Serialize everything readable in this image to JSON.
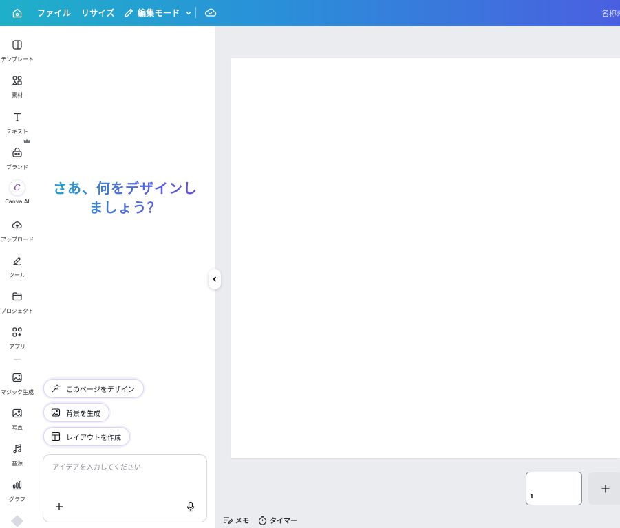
{
  "topbar": {
    "file": "ファイル",
    "resize": "リサイズ",
    "edit_mode": "編集モード",
    "doc_title": "名称未"
  },
  "rail": {
    "items": [
      {
        "label": "テンプレート",
        "icon": "template-icon"
      },
      {
        "label": "素材",
        "icon": "elements-icon"
      },
      {
        "label": "テキスト",
        "icon": "text-icon"
      },
      {
        "label": "ブランド",
        "icon": "brand-icon"
      },
      {
        "label": "Canva AI",
        "icon": "canva-ai-icon"
      },
      {
        "label": "アップロード",
        "icon": "upload-icon"
      },
      {
        "label": "ツール",
        "icon": "tools-icon"
      },
      {
        "label": "プロジェクト",
        "icon": "folder-icon"
      },
      {
        "label": "アプリ",
        "icon": "apps-icon"
      },
      {
        "label": "マジック生成",
        "icon": "magic-media-icon"
      },
      {
        "label": "写真",
        "icon": "photo-icon"
      },
      {
        "label": "音源",
        "icon": "audio-icon"
      },
      {
        "label": "グラフ",
        "icon": "chart-icon"
      }
    ],
    "ai_glyph": "C"
  },
  "panel": {
    "hero_line1": "さあ、何をデザインし",
    "hero_line2": "ましょう？",
    "chips": [
      {
        "label": "このページをデザイン",
        "icon": "sparkle-icon"
      },
      {
        "label": "背景を生成",
        "icon": "image-icon"
      },
      {
        "label": "レイアウトを作成",
        "icon": "layout-icon"
      }
    ],
    "prompt_placeholder": "アイデアを入力してください"
  },
  "canvas": {
    "page_number": "1"
  },
  "footer": {
    "memo": "メモ",
    "timer": "タイマー"
  },
  "colors": {
    "topbar_start": "#1fb0c9",
    "topbar_end": "#4a5fe0",
    "accent": "#7d2ae8"
  }
}
